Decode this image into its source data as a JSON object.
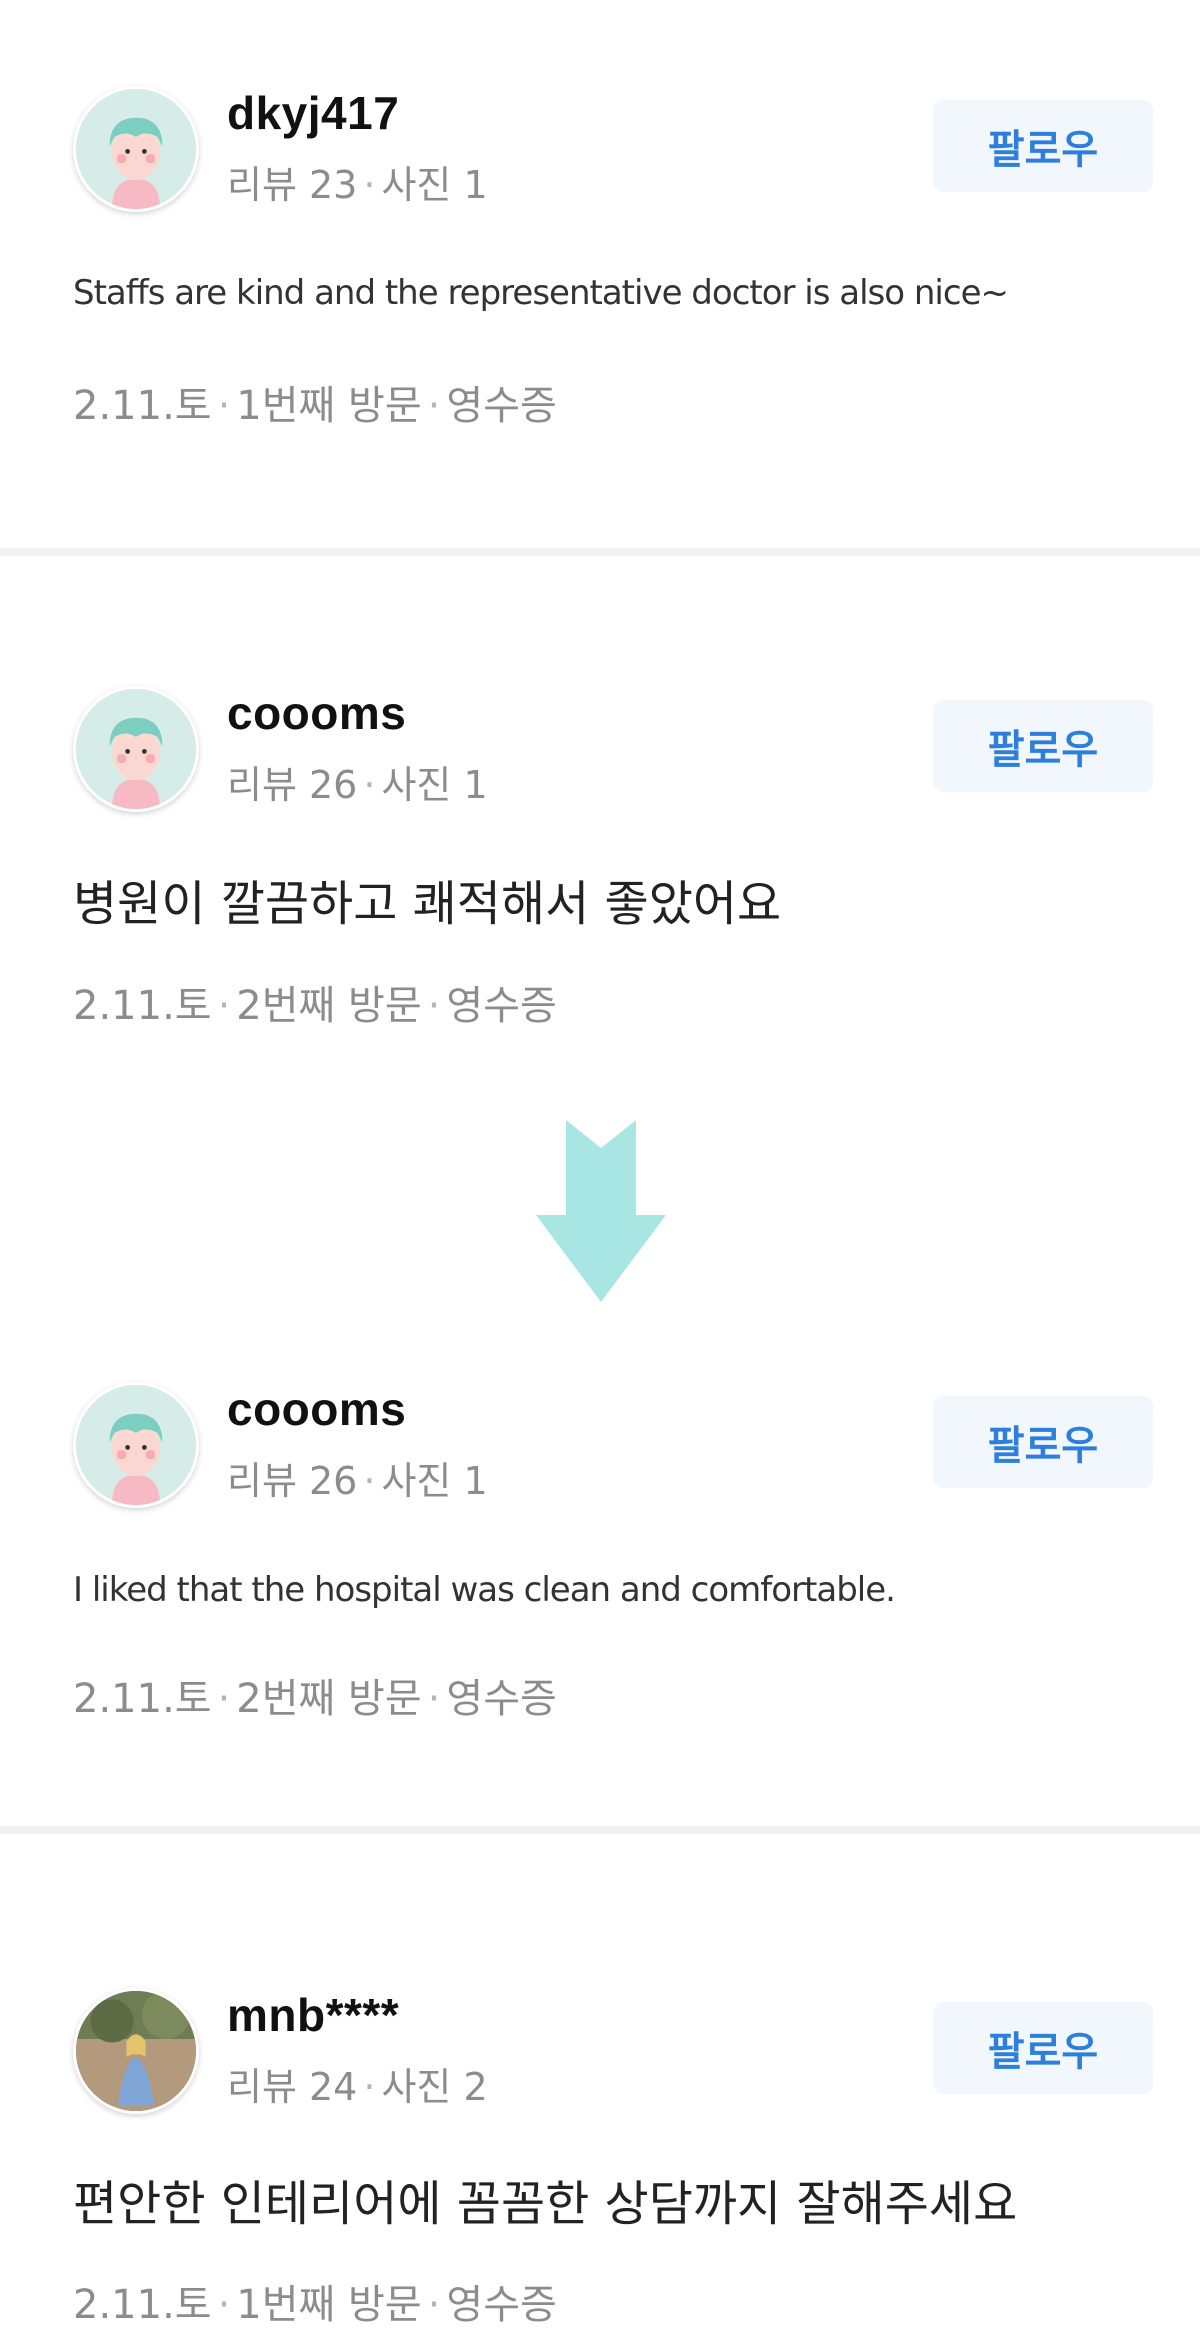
{
  "reviews": [
    {
      "nickname": "dkyj417",
      "review_count_label": "리뷰 23",
      "photo_count_label": "사진 1",
      "follow_label": "팔로우",
      "body": "Staffs are kind and the representative doctor is also nice~",
      "visit_date": "2.11.토",
      "visit_count": "1번째 방문",
      "receipt": "영수증"
    },
    {
      "nickname": "coooms",
      "review_count_label": "리뷰 26",
      "photo_count_label": "사진 1",
      "follow_label": "팔로우",
      "body": "병원이 깔끔하고 쾌적해서 좋았어요",
      "visit_date": "2.11.토",
      "visit_count": "2번째 방문",
      "receipt": "영수증"
    },
    {
      "nickname": "coooms",
      "review_count_label": "리뷰 26",
      "photo_count_label": "사진 1",
      "follow_label": "팔로우",
      "body": "I liked that the hospital was clean and comfortable.",
      "visit_date": "2.11.토",
      "visit_count": "2번째 방문",
      "receipt": "영수증"
    },
    {
      "nickname": "mnb****",
      "review_count_label": "리뷰 24",
      "photo_count_label": "사진 2",
      "follow_label": "팔로우",
      "body": "편안한 인테리어에 꼼꼼한 상담까지 잘해주세요",
      "visit_date": "2.11.토",
      "visit_count": "1번째 방문",
      "receipt": "영수증"
    }
  ],
  "separator": "·",
  "colors": {
    "follow_text": "#2d7fdb",
    "follow_bg": "#f1f7fd",
    "arrow": "#a8e6e3",
    "meta": "#8c8c8c"
  },
  "icons": {
    "avatar_default": "cartoon-avatar-icon",
    "avatar_photo": "photo-avatar",
    "arrow": "down-arrow-icon"
  }
}
